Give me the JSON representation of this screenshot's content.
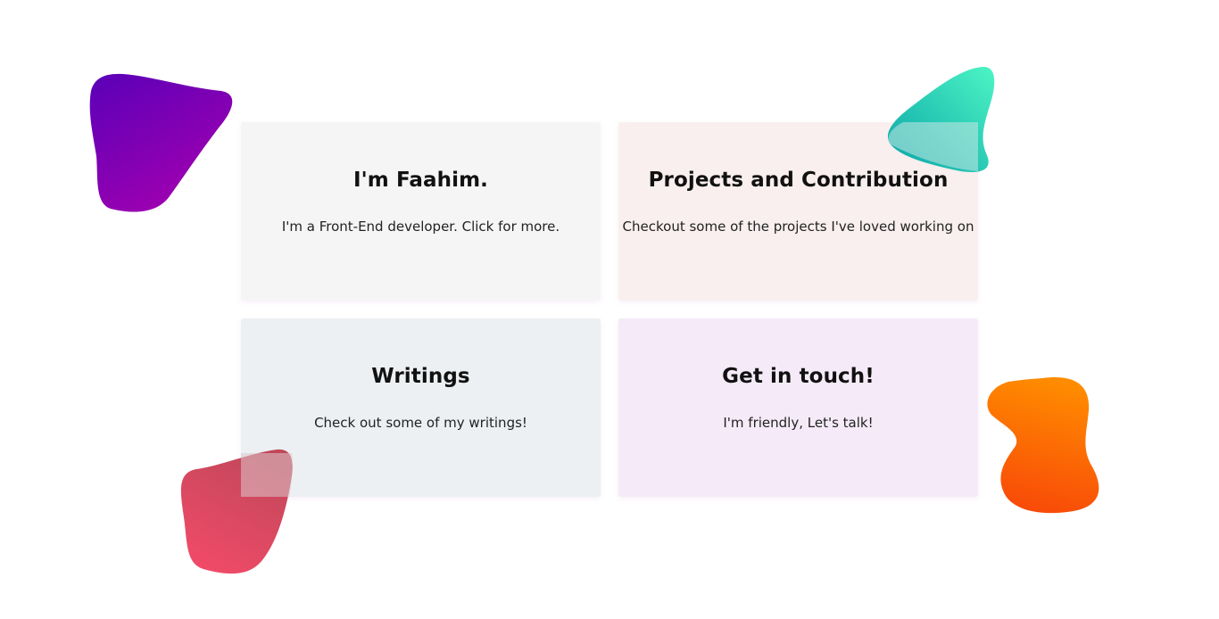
{
  "cards": [
    {
      "title": "I'm Faahim.",
      "description": "I'm a Front-End developer. Click for more."
    },
    {
      "title": "Projects and Contribution",
      "description": "Checkout some of the projects I've loved working on"
    },
    {
      "title": "Writings",
      "description": "Check out some of my writings!"
    },
    {
      "title": "Get in touch!",
      "description": "I'm friendly, Let's talk!"
    }
  ],
  "colors": {
    "card_about_bg": "#f5f5f5",
    "card_projects_bg": "#f9efee",
    "card_writings_bg": "#ecf0f3",
    "card_contact_bg": "#f5ebf8",
    "blob_purple": [
      "#5a00b8",
      "#a000b0"
    ],
    "blob_red": [
      "#c0485a",
      "#f24a68"
    ],
    "blob_teal": [
      "#0aa4a8",
      "#4df5c4"
    ],
    "blob_orange": [
      "#ff8c00",
      "#f84808"
    ]
  },
  "decorations": [
    "purple-blob",
    "red-blob",
    "teal-blob",
    "orange-blob"
  ]
}
